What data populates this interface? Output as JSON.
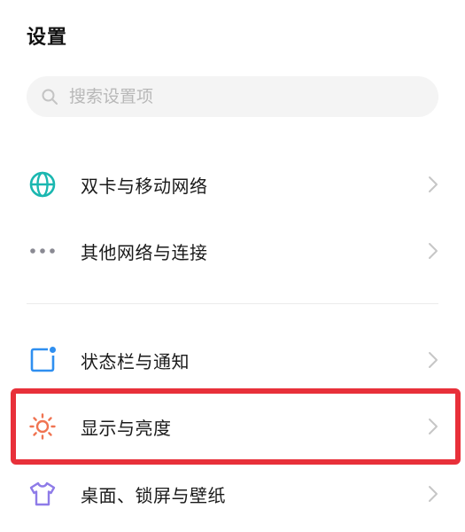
{
  "header": {
    "title": "设置"
  },
  "search": {
    "placeholder": "搜索设置项",
    "value": ""
  },
  "items": [
    {
      "label": "双卡与移动网络",
      "icon": "globe-icon",
      "color": "#1ab7b0"
    },
    {
      "label": "其他网络与连接",
      "icon": "more-dots-icon",
      "color": "#8a8a93"
    },
    {
      "label": "状态栏与通知",
      "icon": "status-bar-icon",
      "color": "#2f8ff0"
    },
    {
      "label": "显示与亮度",
      "icon": "sun-icon",
      "color": "#f07452"
    },
    {
      "label": "桌面、锁屏与壁纸",
      "icon": "tshirt-icon",
      "color": "#8e7be8"
    }
  ],
  "colors": {
    "highlight": "#e8303a"
  }
}
